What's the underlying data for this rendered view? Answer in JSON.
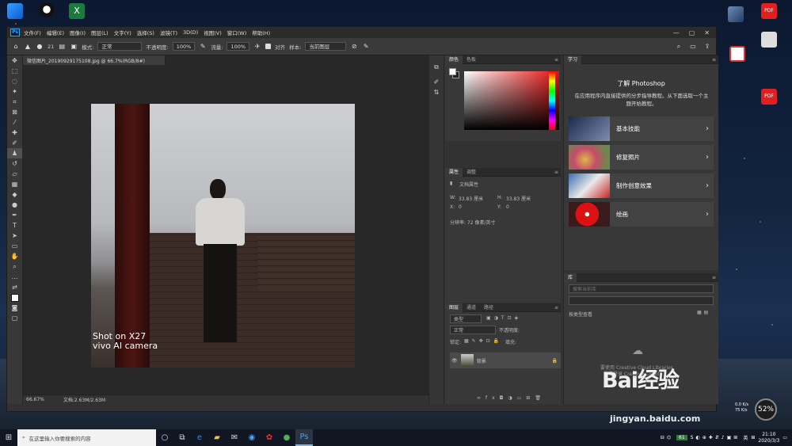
{
  "desktop": {
    "left_icons": [
      {
        "label": "",
        "icon": "computer-icon"
      },
      {
        "label": "",
        "icon": "qq-icon"
      },
      {
        "label": "",
        "icon": "excel-icon"
      }
    ],
    "right_icons": [
      {
        "label": "",
        "icon": "game-icon"
      },
      {
        "label": "PDF",
        "icon": "pdf-icon"
      },
      {
        "label": "",
        "icon": "blurred-icon"
      },
      {
        "label": "",
        "icon": "wps-icon"
      },
      {
        "label": "PDF",
        "icon": "pdf-icon"
      }
    ]
  },
  "menu": {
    "items": [
      "文件(F)",
      "编辑(E)",
      "图像(I)",
      "图层(L)",
      "文字(Y)",
      "选择(S)",
      "滤镜(T)",
      "3D(D)",
      "视图(V)",
      "窗口(W)",
      "帮助(H)"
    ],
    "logo": "Ps"
  },
  "options": {
    "brush_size": "21",
    "mode_label": "模式:",
    "mode_value": "正常",
    "opacity_label": "不透明度:",
    "opacity_value": "100%",
    "flow_label": "流量:",
    "flow_value": "100%",
    "aligned_label": "对齐",
    "sample_label": "样本:",
    "sample_value": "当前图层"
  },
  "document": {
    "tab_title": "微信图片_20190929175108.jpg @ 66.7%(RGB/8#)",
    "zoom": "66.67%",
    "doc_size": "文档:2.63M/2.63M",
    "watermark_line1": "Shot on X27",
    "watermark_line2": "vivo AI camera"
  },
  "color_panel": {
    "tabs": [
      "颜色",
      "色板"
    ]
  },
  "properties_panel": {
    "tabs": [
      "属性",
      "调整"
    ],
    "doc_label": "文档属性",
    "w_label": "W:",
    "w_value": "33.83 厘米",
    "h_label": "H:",
    "h_value": "33.83 厘米",
    "x_label": "X:",
    "x_value": "0",
    "y_label": "Y:",
    "y_value": "0",
    "resolution": "分辨率: 72 像素/英寸"
  },
  "layers_panel": {
    "tabs": [
      "图层",
      "通道",
      "路径"
    ],
    "kind_label": "类型",
    "mode": "正常",
    "opacity_label": "不透明度:",
    "lock_label": "锁定:",
    "fill_label": "填充:",
    "layer_name": "背景"
  },
  "learn_panel": {
    "tab": "学习",
    "title": "了解 Photoshop",
    "desc": "在应用程序内直接提供的分步指导教程。从下面选取一个主题开始教程。",
    "items": [
      "基本技能",
      "修复照片",
      "制作创意效果",
      "绘画"
    ]
  },
  "library_panel": {
    "tab": "库",
    "search_placeholder": "搜索当前库",
    "browse_label": "按类型查看",
    "cc_text_1": "要使用 Creative Cloud Libraries,",
    "cc_text_2": "需要登录 Creative Cloud"
  },
  "taskbar": {
    "search_placeholder": "在这里输入你要搜索的内容",
    "time": "21:10",
    "date": "2020/3/3",
    "ime": "英",
    "battery": "61"
  },
  "overlay": {
    "baidu_logo": "Bai经验",
    "baidu_url": "jingyan.baidu.com",
    "gauge": "52%",
    "net_up": "0.0 K/s",
    "net_down": "75 K/s"
  }
}
